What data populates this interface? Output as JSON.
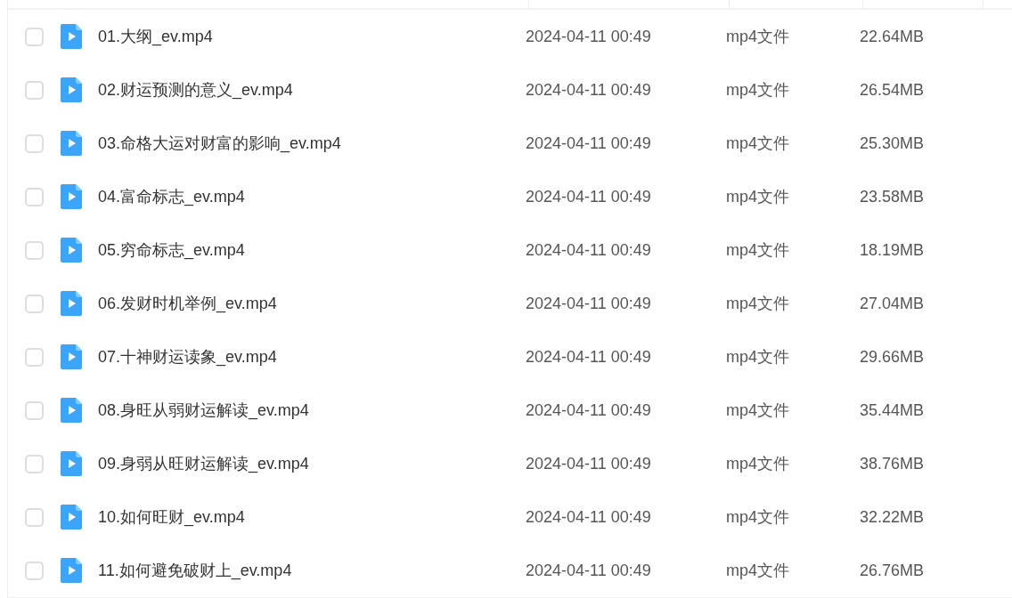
{
  "files": [
    {
      "name": "01.大纲_ev.mp4",
      "modified": "2024-04-11 00:49",
      "type": "mp4文件",
      "size": "22.64MB",
      "checked": false
    },
    {
      "name": "02.财运预测的意义_ev.mp4",
      "modified": "2024-04-11 00:49",
      "type": "mp4文件",
      "size": "26.54MB",
      "checked": false
    },
    {
      "name": "03.命格大运对财富的影响_ev.mp4",
      "modified": "2024-04-11 00:49",
      "type": "mp4文件",
      "size": "25.30MB",
      "checked": false
    },
    {
      "name": "04.富命标志_ev.mp4",
      "modified": "2024-04-11 00:49",
      "type": "mp4文件",
      "size": "23.58MB",
      "checked": false
    },
    {
      "name": "05.穷命标志_ev.mp4",
      "modified": "2024-04-11 00:49",
      "type": "mp4文件",
      "size": "18.19MB",
      "checked": false
    },
    {
      "name": "06.发财时机举例_ev.mp4",
      "modified": "2024-04-11 00:49",
      "type": "mp4文件",
      "size": "27.04MB",
      "checked": false
    },
    {
      "name": "07.十神财运读象_ev.mp4",
      "modified": "2024-04-11 00:49",
      "type": "mp4文件",
      "size": "29.66MB",
      "checked": false
    },
    {
      "name": "08.身旺从弱财运解读_ev.mp4",
      "modified": "2024-04-11 00:49",
      "type": "mp4文件",
      "size": "35.44MB",
      "checked": false
    },
    {
      "name": "09.身弱从旺财运解读_ev.mp4",
      "modified": "2024-04-11 00:49",
      "type": "mp4文件",
      "size": "38.76MB",
      "checked": false
    },
    {
      "name": "10.如何旺财_ev.mp4",
      "modified": "2024-04-11 00:49",
      "type": "mp4文件",
      "size": "32.22MB",
      "checked": false
    },
    {
      "name": "11.如何避免破财上_ev.mp4",
      "modified": "2024-04-11 00:49",
      "type": "mp4文件",
      "size": "26.76MB",
      "checked": false
    }
  ]
}
